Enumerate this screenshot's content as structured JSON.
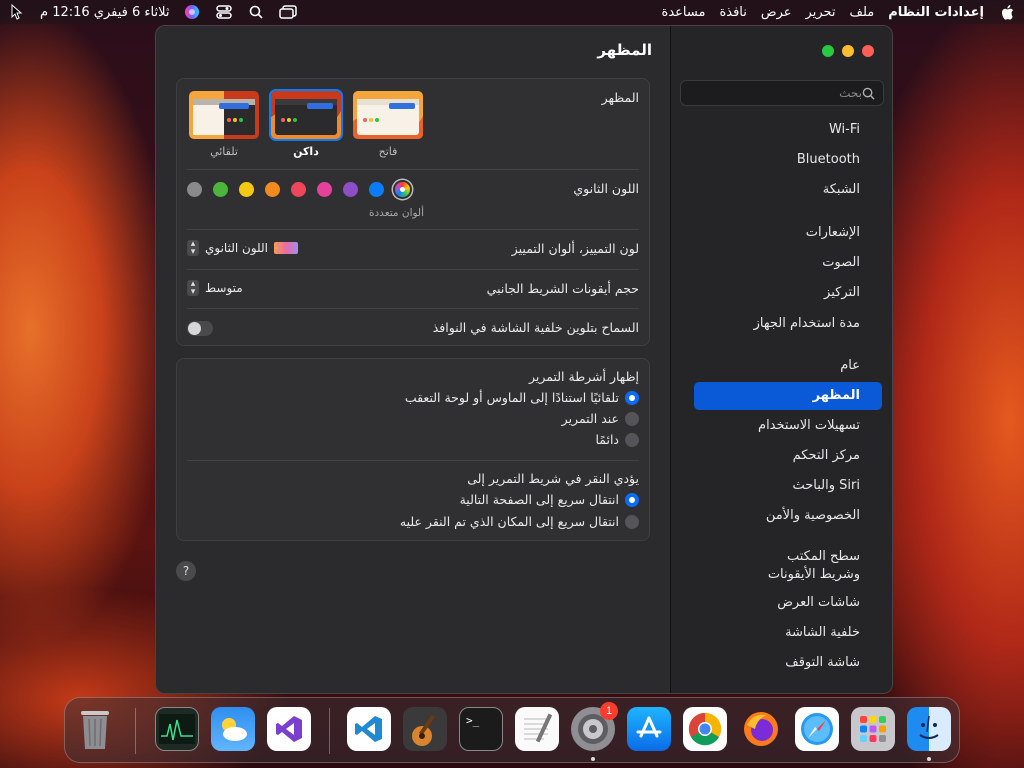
{
  "menubar": {
    "apple": "",
    "app_name": "إعدادات النظام",
    "menus": [
      "ملف",
      "تحرير",
      "عرض",
      "نافذة",
      "مساعدة"
    ],
    "clock": "ثلاثاء 6 فيفري 12:16 م"
  },
  "window": {
    "title": "المظهر",
    "search_placeholder": "بحث"
  },
  "sidebar": {
    "items": [
      {
        "label": "Wi-Fi"
      },
      {
        "label": "Bluetooth"
      },
      {
        "label": "الشبكة"
      },
      {
        "label": "الإشعارات"
      },
      {
        "label": "الصوت"
      },
      {
        "label": "التركيز"
      },
      {
        "label": "مدة استخدام الجهاز"
      },
      {
        "label": "عام"
      },
      {
        "label": "المظهر"
      },
      {
        "label": "تسهيلات الاستخدام"
      },
      {
        "label": "مركز التحكم"
      },
      {
        "label": "Siri والباحث"
      },
      {
        "label": "الخصوصية والأمن"
      },
      {
        "label": "سطح المكتب\nوشريط الأيقونات"
      },
      {
        "label": "شاشات العرض"
      },
      {
        "label": "خلفية الشاشة"
      },
      {
        "label": "شاشة التوقف"
      }
    ]
  },
  "appearance": {
    "label": "المظهر",
    "options": [
      {
        "label": "فاتح"
      },
      {
        "label": "داكن"
      },
      {
        "label": "تلقائي"
      }
    ],
    "selected": "داكن"
  },
  "accent": {
    "label": "اللون الثانوي",
    "selected_caption": "ألوان متعددة",
    "colors": [
      "#0a7cff",
      "#8e4ec6",
      "#e5419a",
      "#f0455a",
      "#f28a1e",
      "#f6c80f",
      "#4db53c",
      "#8a8a8d"
    ]
  },
  "highlight": {
    "label": "لون التمييز، ألوان التمييز",
    "value": "اللون الثانوي"
  },
  "sidebar_icon_size": {
    "label": "حجم أيقونات الشريط الجانبي",
    "value": "متوسط"
  },
  "wallpaper_tinting": {
    "label": "السماح بتلوين خلفية الشاشة في النوافذ",
    "enabled": false
  },
  "scrollbars": {
    "show_label": "إظهار أشرطة التمرير",
    "show_options": [
      {
        "label": "تلقائيًا استنادًا إلى الماوس أو لوحة التعقب",
        "selected": true
      },
      {
        "label": "عند التمرير",
        "selected": false
      },
      {
        "label": "دائمًا",
        "selected": false
      }
    ],
    "click_label": "يؤدي النقر في شريط التمرير إلى",
    "click_options": [
      {
        "label": "انتقال سريع إلى الصفحة التالية",
        "selected": true
      },
      {
        "label": "انتقال سريع إلى المكان الذي تم النقر عليه",
        "selected": false
      }
    ]
  },
  "help": "?",
  "dock": {
    "badge_count": "1"
  }
}
